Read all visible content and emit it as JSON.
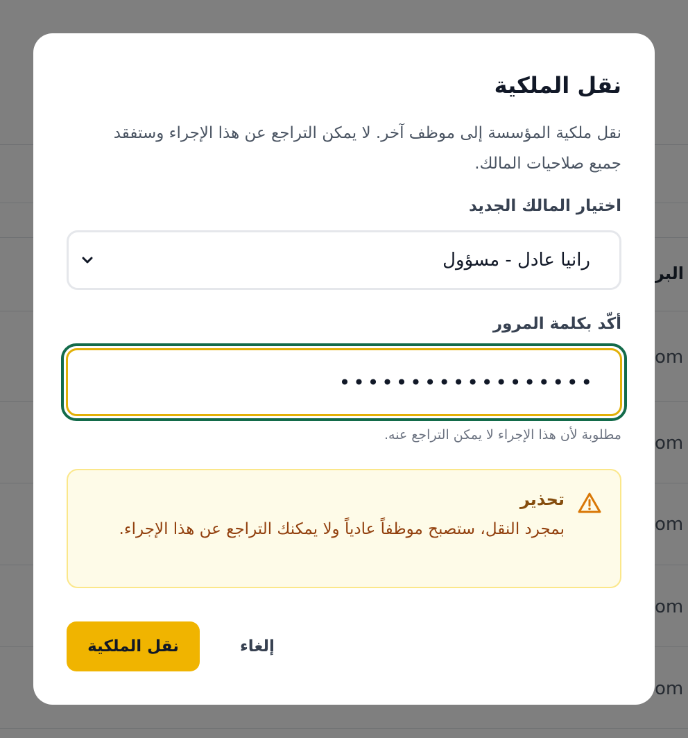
{
  "background": {
    "table_header_fragment": "البر",
    "row_cells": [
      "om",
      "om",
      "om",
      "om",
      "om"
    ]
  },
  "dialog": {
    "title": "نقل الملكية",
    "description": "نقل ملكية المؤسسة إلى موظف آخر. لا يمكن التراجع عن هذا الإجراء وستفقد جميع صلاحيات المالك.",
    "new_owner": {
      "label": "اختيار المالك الجديد",
      "selected_value": "رانيا عادل - مسؤول",
      "icon": "chevron-down-icon"
    },
    "password": {
      "label": "أكّد بكلمة المرور",
      "masked_value": "••••••••••••••••••",
      "helper": "مطلوبة لأن هذا الإجراء لا يمكن التراجع عنه."
    },
    "warning": {
      "icon": "warning-triangle-icon",
      "title": "تحذير",
      "text": "بمجرد النقل، ستصبح موظفاً عادياً ولا يمكنك التراجع عن هذا الإجراء."
    },
    "actions": {
      "confirm_label": "نقل الملكية",
      "cancel_label": "إلغاء"
    }
  },
  "colors": {
    "primary": "#f0b400",
    "focus_ring": "#136b4a",
    "warning_bg": "#fefbe8",
    "warning_text": "#92400e"
  }
}
